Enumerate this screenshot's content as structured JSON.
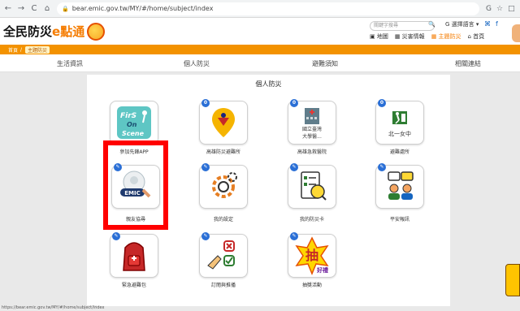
{
  "browser": {
    "url": "bear.emic.gov.tw/MY/#/home/subject/index",
    "back_glyph": "←",
    "forward_glyph": "→",
    "reload_glyph": "C",
    "home_glyph": "⌂",
    "lock_glyph": "🔒",
    "right_icons": [
      "G",
      "☆",
      "□"
    ]
  },
  "site": {
    "logo_text_a": "全民防災",
    "logo_text_b": "e點通",
    "search_placeholder": "關鍵字搜尋",
    "search_glyph": "🔍",
    "lang": "G 選擇語言 ▾",
    "social": [
      "⌘",
      "f"
    ],
    "toplinks": [
      {
        "label": "▣ 地圖",
        "active": false
      },
      {
        "label": "▦ 災害情報",
        "active": false
      },
      {
        "label": "▦ 主題防災",
        "active": true
      },
      {
        "label": "⌂ 首頁",
        "active": false
      }
    ]
  },
  "breadcrumb": {
    "home": "首頁",
    "sep": "/",
    "current": "主題防災"
  },
  "menu": [
    "生活資訊",
    "個人防災",
    "避難須知",
    "相關連結"
  ],
  "panel": {
    "title": "個人防災",
    "tiles": [
      {
        "label": "參加先鋒APP",
        "badge": "",
        "icon": "first-on-scene-icon"
      },
      {
        "label": "高雄防災避難所",
        "badge": "0",
        "icon": "location-pin-icon"
      },
      {
        "label": "高雄急救醫院",
        "badge": "0",
        "icon": "hospital-icon"
      },
      {
        "label": "避難處所",
        "badge": "0",
        "icon": "exit-sign-icon"
      },
      {
        "label": "親友協尋",
        "badge": "✎",
        "icon": "emic-search-icon"
      },
      {
        "label": "我的設定",
        "badge": "✎",
        "icon": "gear-icon"
      },
      {
        "label": "我的防災卡",
        "badge": "✎",
        "icon": "checklist-icon"
      },
      {
        "label": "平安報訊",
        "badge": "✎",
        "icon": "chat-people-icon"
      },
      {
        "label": "緊急避難包",
        "badge": "✎",
        "icon": "backpack-icon"
      },
      {
        "label": "訂閱與推播",
        "badge": "✎",
        "icon": "hand-checklist-icon"
      },
      {
        "label": "抽獎活動",
        "badge": "✎",
        "icon": "lottery-icon"
      }
    ],
    "tile_texts": {
      "fos_line1": "FirS",
      "fos_line2": "On",
      "fos_line3": "Scene",
      "hospital_line1": "國立臺灣",
      "hospital_line2": "大學醫...",
      "school": "北一女中",
      "emic": "EMIC",
      "lottery": "抽",
      "lottery_small": "好禮"
    }
  },
  "status": "https://bear.emic.gov.tw/MY/#/home/subject/index",
  "colors": {
    "orange": "#f39200",
    "badge_blue": "#2a6fd6",
    "highlight_red": "#ff0000"
  }
}
